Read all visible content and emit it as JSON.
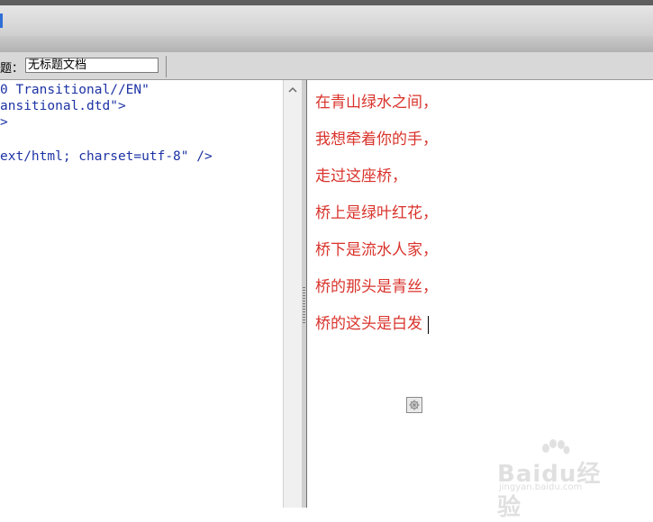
{
  "toolbar": {
    "accent_color": "#2f6fd6"
  },
  "document": {
    "title_label": "题：",
    "title_value": "无标题文档"
  },
  "code_view": {
    "lines": [
      "0 Transitional//EN\"",
      "ansitional.dtd\">",
      "",
      "",
      "ext/html; charset=utf-8\" />"
    ],
    "text_color": "#1d33a4"
  },
  "design_view": {
    "text_color": "#d9332b",
    "poem_lines": [
      "在青山绿水之间，",
      "我想牵着你的手，",
      "走过这座桥，",
      "桥上是绿叶红花，",
      "桥下是流水人家，",
      "桥的那头是青丝，",
      "桥的这头是白发"
    ],
    "placeholder_icon": "broken-image-icon"
  },
  "watermark": {
    "brand": "Baidu经验",
    "url": "jingyan.baidu.com"
  }
}
